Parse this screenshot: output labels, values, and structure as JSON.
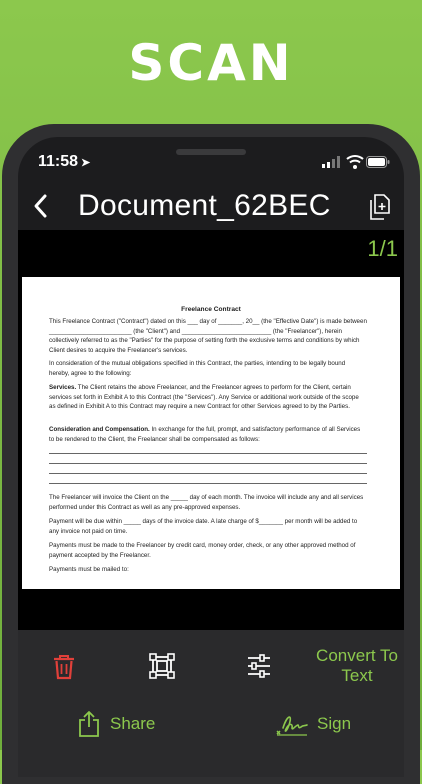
{
  "hero": {
    "title": "SCAN"
  },
  "status": {
    "time": "11:58",
    "location_glyph": "➤"
  },
  "nav": {
    "title": "Document_62BEC",
    "back_icon": "chevron-left-icon",
    "pages_icon": "add-page-icon"
  },
  "viewer": {
    "page_indicator": "1/1"
  },
  "document": {
    "title": "Freelance Contract",
    "p1": "This Freelance Contract (\"Contract\") dated on this ___ day of _______, 20__ (the \"Effective Date\") is made between ________________________ (the \"Client\") and __________________________ (the \"Freelancer\"), herein collectively referred to as the \"Parties\" for the purpose of setting forth the exclusive terms and conditions by which Client desires to acquire the Freelancer's services.",
    "p2": "In consideration of the mutual obligations specified in this Contract, the parties, intending to be legally bound hereby, agree to the following:",
    "p3_label": "Services.",
    "p3": " The Client retains the above Freelancer, and the Freelancer agrees to perform for the Client, certain services set forth in Exhibit A to this Contract (the \"Services\"). Any Service or additional work outside of the scope as defined in Exhibit A to this Contract may require a new Contract for other Services agreed to by the Parties.",
    "p4_label": "Consideration and Compensation.",
    "p4": " In exchange for the full, prompt, and satisfactory performance of all Services to be rendered to the Client, the Freelancer shall be compensated as follows:",
    "p5": "The Freelancer will invoice the Client on the _____ day of each month. The invoice will include any and all services performed under this Contract as well as any pre-approved expenses.",
    "p6": "Payment will be due within _____ days of the invoice date. A late charge of $_______ per month will be added to any invoice not paid on time.",
    "p7": "Payments must be made to the Freelancer by credit card, money order, check, or any other approved method of payment accepted by the Freelancer.",
    "p8": "Payments must be mailed to:"
  },
  "toolbar": {
    "delete_icon": "trash-icon",
    "crop_icon": "crop-icon",
    "adjust_icon": "sliders-icon",
    "convert_label": "Convert To Text",
    "share_label": "Share",
    "sign_label": "Sign"
  },
  "colors": {
    "accent": "#8cc84d",
    "delete": "#e0403a",
    "background": "#1c1c1e"
  }
}
